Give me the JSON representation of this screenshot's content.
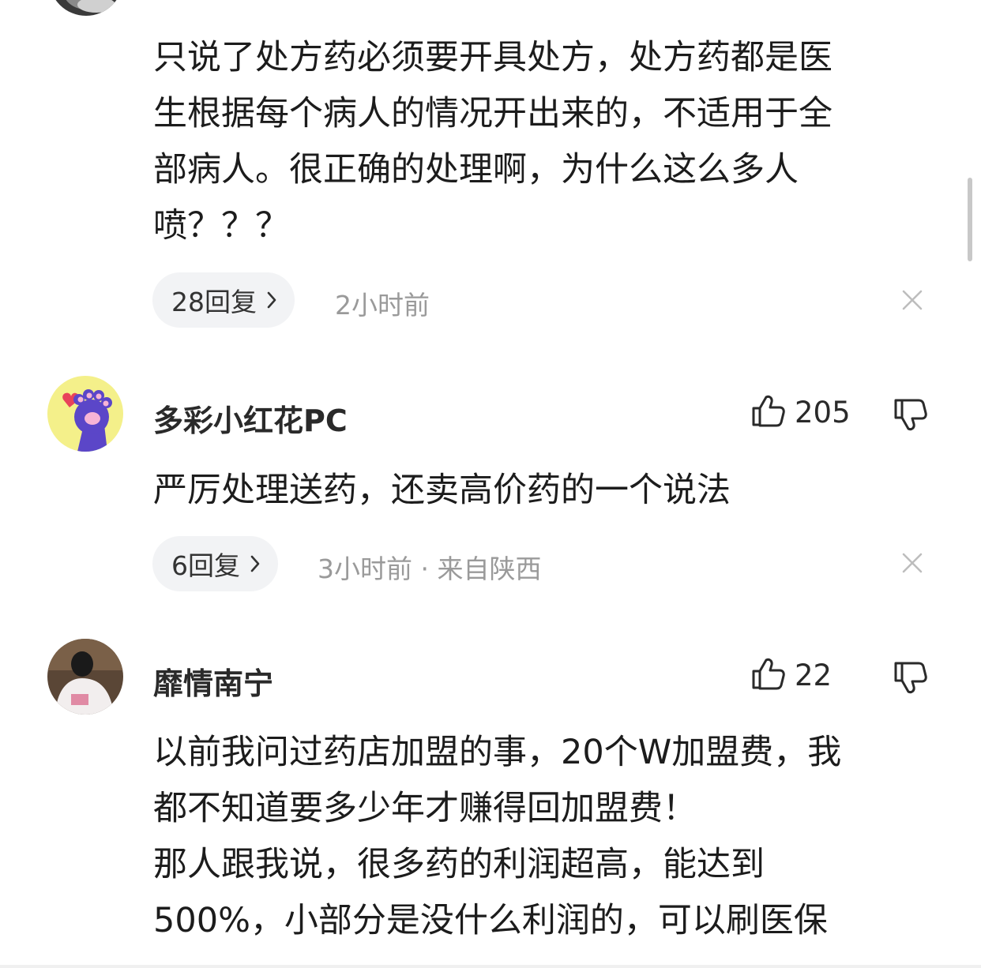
{
  "comments": [
    {
      "text_lines": [
        "只说了处方药必须要开具处方，处方药都是医",
        "生根据每个病人的情况开出来的，不适用于全",
        "部病人。很正确的处理啊，为什么这么多人",
        "喷？？？"
      ],
      "reply_label": "28回复",
      "meta": "2小时前",
      "close_icon": "close-icon"
    },
    {
      "username": "多彩小红花PC",
      "likes": "205",
      "text_lines": [
        "严厉处理送药，还卖高价药的一个说法"
      ],
      "reply_label": "6回复",
      "meta": "3小时前 · 来自陕西",
      "avatar_icon": "paw-avatar-icon"
    },
    {
      "username": "靡情南宁",
      "likes": "22",
      "text_lines": [
        "以前我问过药店加盟的事，20个W加盟费，我",
        "都不知道要多少年才赚得回加盟费！",
        "那人跟我说，很多药的利润超高，能达到",
        "500%，小部分是没什么利润的，可以刷医保"
      ],
      "avatar_icon": "person-photo-avatar"
    }
  ],
  "colors": {
    "text": "#1c1c1c",
    "meta": "#9a9a9a",
    "pill_bg": "#f2f3f5",
    "avatar_yellow": "#f4f08a",
    "paw_purple": "#5b46c8"
  }
}
